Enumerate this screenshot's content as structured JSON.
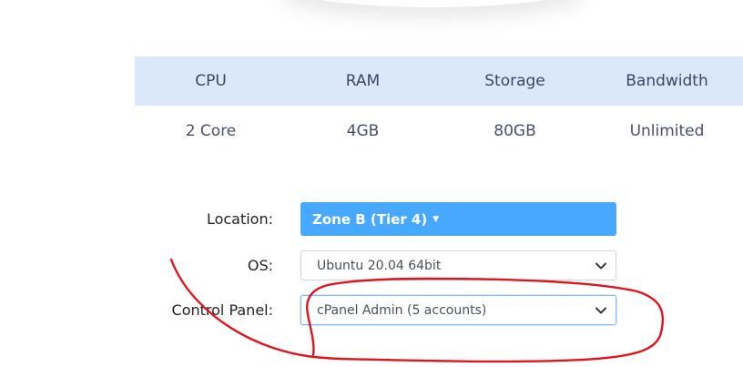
{
  "specs": {
    "headers": [
      "CPU",
      "RAM",
      "Storage",
      "Bandwidth"
    ],
    "values": [
      "2 Core",
      "4GB",
      "80GB",
      "Unlimited"
    ]
  },
  "form": {
    "location": {
      "label": "Location:",
      "value": "Zone B (Tier 4)",
      "icon": "caret-down-icon"
    },
    "os": {
      "label": "OS:",
      "value": "Ubuntu 20.04 64bit",
      "icon": "chevron-down-icon"
    },
    "control_panel": {
      "label": "Control Panel:",
      "value": "cPanel Admin (5 accounts)",
      "icon": "chevron-down-icon"
    }
  },
  "colors": {
    "header_bg": "#dbe8fb",
    "accent": "#47a8ff",
    "annotation": "#e0141e"
  }
}
